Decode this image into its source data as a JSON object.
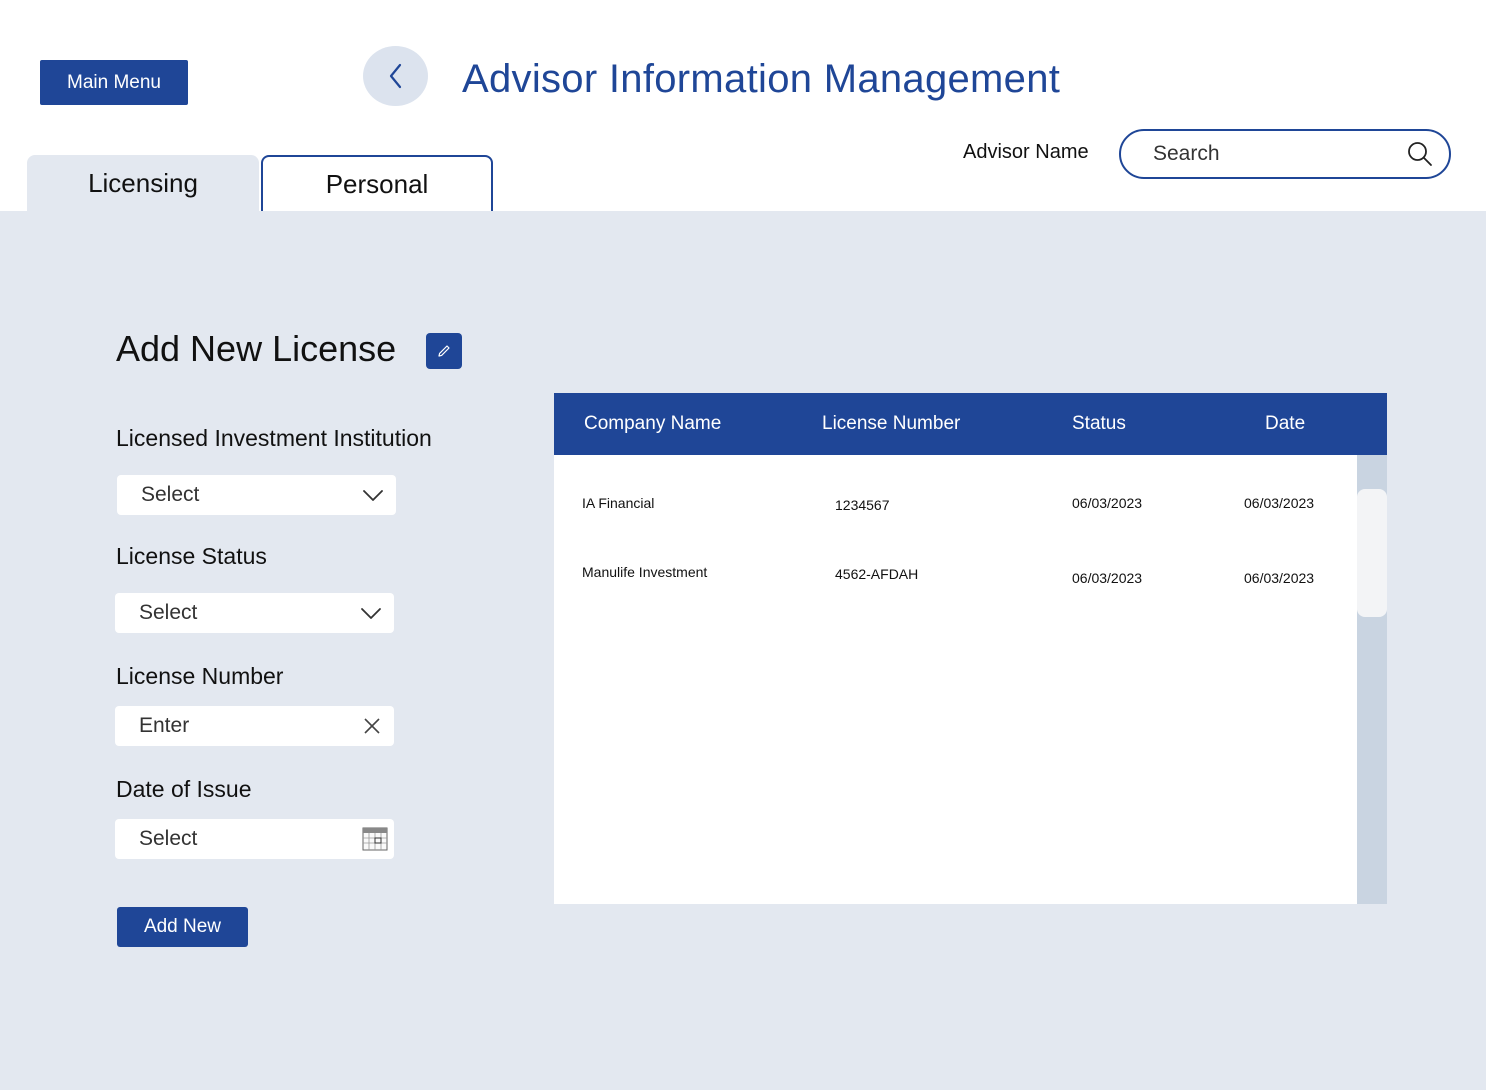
{
  "header": {
    "main_menu_label": "Main Menu",
    "title": "Advisor Information Management",
    "advisor_label": "Advisor Name",
    "search_placeholder": "Search"
  },
  "tabs": [
    {
      "label": "Licensing",
      "active": true
    },
    {
      "label": "Personal",
      "active": false
    }
  ],
  "form": {
    "title": "Add New License",
    "fields": [
      {
        "label": "Licensed Investment Institution",
        "value": "Select",
        "icon": "chevron-down-icon"
      },
      {
        "label": "License Status",
        "value": "Select",
        "icon": "chevron-down-icon"
      },
      {
        "label": "License Number",
        "value": "Enter",
        "icon": "clear-icon"
      },
      {
        "label": "Date of Issue",
        "value": "Select",
        "icon": "calendar-icon"
      }
    ],
    "submit_label": "Add New"
  },
  "table": {
    "columns": [
      "Company Name",
      "License Number",
      "Status",
      "Date"
    ],
    "rows": [
      {
        "company": "IA Financial",
        "license": "1234567",
        "status": "06/03/2023",
        "date": "06/03/2023"
      },
      {
        "company": "Manulife Investment",
        "license": "4562-AFDAH",
        "status": "06/03/2023",
        "date": "06/03/2023"
      }
    ]
  },
  "colors": {
    "primary": "#1f4697",
    "content_background": "#e3e8f0",
    "back_button": "#dce3ee",
    "scroll_track": "#c9d4e1"
  }
}
